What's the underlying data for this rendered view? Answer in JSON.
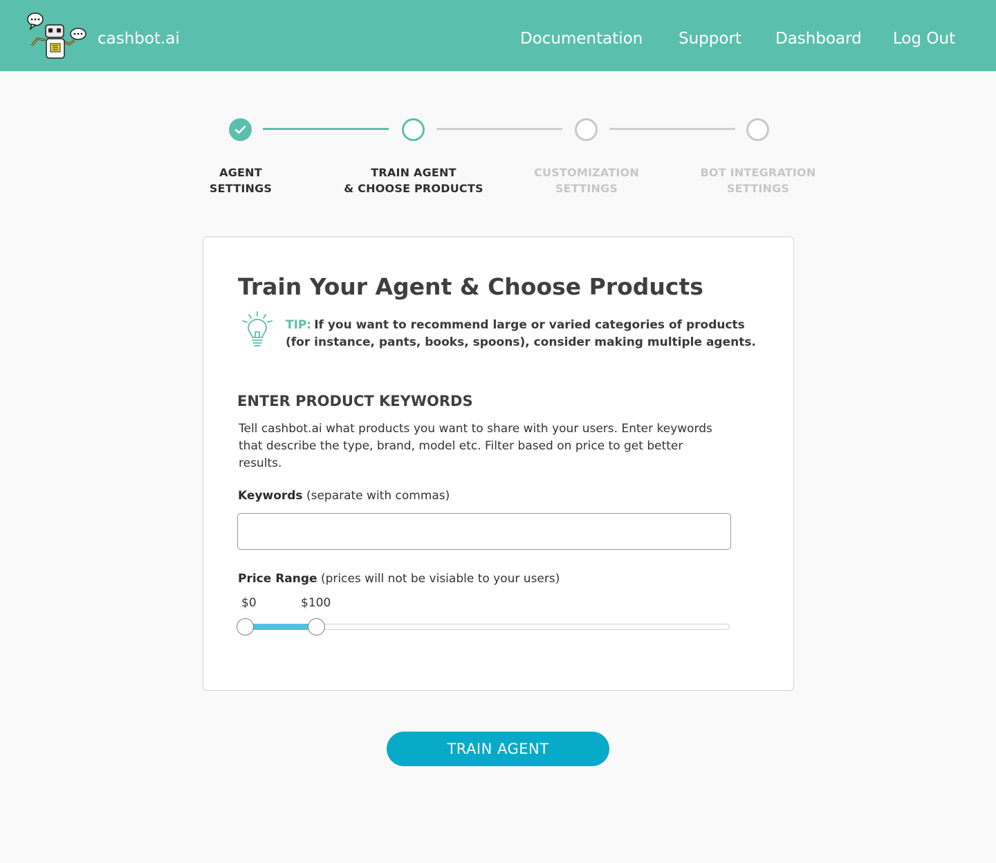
{
  "header": {
    "brand": "cashbot.ai",
    "nav": [
      "Documentation",
      "Support",
      "Dashboard",
      "Log Out"
    ],
    "background_color": "#5bbfad"
  },
  "stepper": {
    "steps": [
      {
        "line1": "AGENT",
        "line2": "SETTINGS",
        "state": "completed"
      },
      {
        "line1": "TRAIN AGENT",
        "line2": "& CHOOSE PRODUCTS",
        "state": "active"
      },
      {
        "line1": "CUSTOMIZATION",
        "line2": "SETTINGS",
        "state": "upcoming"
      },
      {
        "line1": "BOT INTEGRATION",
        "line2": "SETTINGS",
        "state": "upcoming"
      }
    ],
    "completed_icon": "check-icon"
  },
  "card": {
    "title": "Train Your Agent & Choose Products",
    "tip": {
      "icon": "lightbulb-icon",
      "label": "TIP:",
      "text": "If you want to recommend large or varied categories of products (for instance, pants, books, spoons), consider making multiple agents."
    },
    "section_heading": "ENTER PRODUCT KEYWORDS",
    "section_description": "Tell cashbot.ai what products you want to share with your users. Enter keywords that describe the type, brand, model etc. Filter based on price to get better results.",
    "keywords": {
      "label": "Keywords",
      "hint": "(separate with commas)",
      "value": "",
      "placeholder": ""
    },
    "price_range": {
      "label": "Price Range",
      "hint": "(prices will not be visiable to your users)",
      "min_label": "$0",
      "max_label": "$100",
      "selected_min_fraction": 0.0,
      "selected_max_fraction": 0.146
    }
  },
  "actions": {
    "train_button": "TRAIN AGENT"
  },
  "colors": {
    "accent": "#5bbfad",
    "button": "#07aac8",
    "slider_fill": "#4fc3dc",
    "inactive": "#c8c8c8"
  }
}
